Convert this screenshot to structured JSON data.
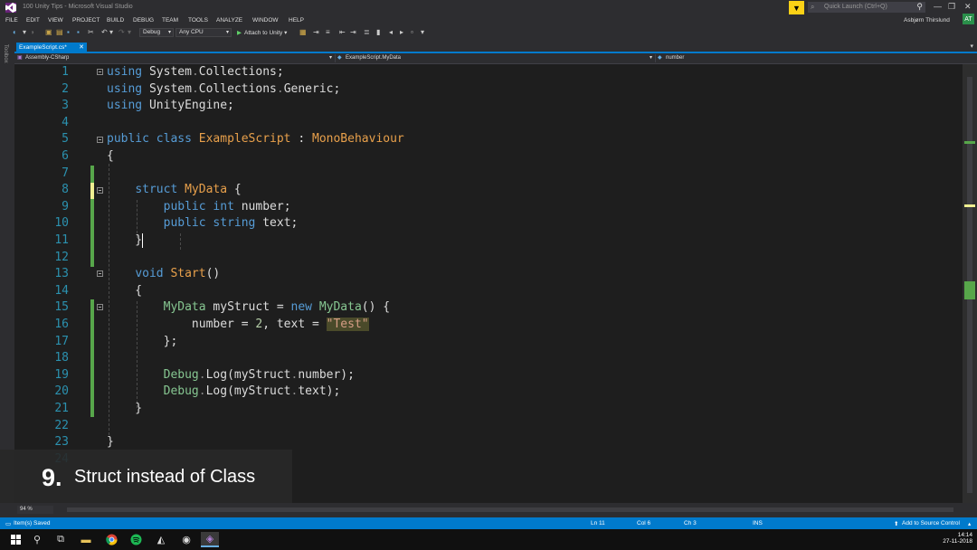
{
  "window": {
    "title": "100 Unity Tips - Microsoft Visual Studio"
  },
  "quick_launch": {
    "placeholder": "Quick Launch (Ctrl+Q)"
  },
  "menu": [
    "FILE",
    "EDIT",
    "VIEW",
    "PROJECT",
    "BUILD",
    "DEBUG",
    "TEAM",
    "TOOLS",
    "ANALYZE",
    "WINDOW",
    "HELP"
  ],
  "user": {
    "name": "Asbjørn Thirslund",
    "initials": "AT"
  },
  "toolbar": {
    "config": "Debug",
    "platform": "Any CPU",
    "attach": "Attach to Unity"
  },
  "sidebar": {
    "toolbox": "Toolbox"
  },
  "tab": {
    "label": "ExampleScript.cs*"
  },
  "navbar": {
    "project": "Assembly-CSharp",
    "type": "ExampleScript.MyData",
    "member": "number"
  },
  "code": {
    "line_numbers": [
      "1",
      "2",
      "3",
      "4",
      "5",
      "6",
      "7",
      "8",
      "9",
      "10",
      "11",
      "12",
      "13",
      "14",
      "15",
      "16",
      "17",
      "18",
      "19",
      "20",
      "21",
      "22",
      "23",
      "24"
    ]
  },
  "zoom": "94 %",
  "caption": {
    "number": "9.",
    "text": "Struct instead of Class"
  },
  "status": {
    "left": "Item(s) Saved",
    "ln": "Ln 11",
    "col": "Col 6",
    "ch": "Ch 3",
    "ins": "INS",
    "source_control": "Add to Source Control"
  },
  "clock": {
    "time": "14:14",
    "date": "27-11-2018"
  },
  "colors": {
    "accent": "#007acc",
    "keyword": "#569cd6",
    "type": "#e8a04b",
    "type_alt": "#86c691",
    "change_bar": "#57a64a"
  },
  "icons": [
    "vs-logo-icon",
    "filter-icon",
    "search-icon",
    "minimize-icon",
    "maximize-icon",
    "close-icon",
    "play-icon",
    "windows-start-icon",
    "search-taskbar-icon",
    "task-view-icon",
    "file-explorer-icon",
    "chrome-icon",
    "spotify-icon",
    "unity-icon",
    "visual-studio-icon"
  ]
}
